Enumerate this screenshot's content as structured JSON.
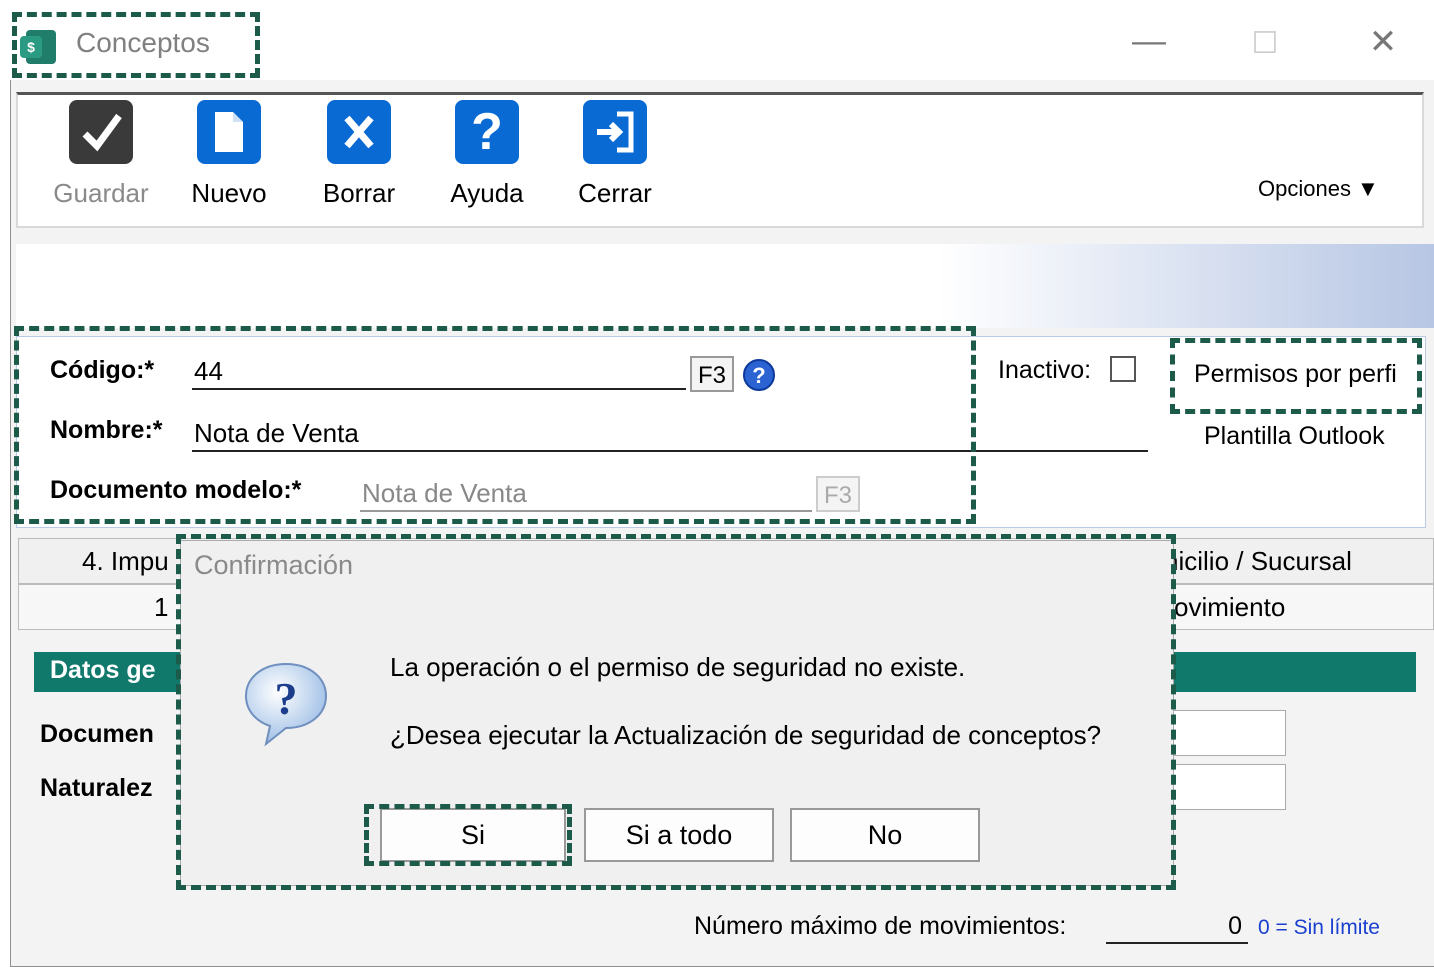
{
  "window": {
    "title": "Conceptos",
    "controls": {
      "minimize": "—",
      "maximize": "☐",
      "close": "✕"
    }
  },
  "toolbar": {
    "buttons": [
      {
        "label": "Guardar",
        "icon": "check-icon",
        "enabled": false
      },
      {
        "label": "Nuevo",
        "icon": "document-icon",
        "enabled": true
      },
      {
        "label": "Borrar",
        "icon": "delete-x-icon",
        "enabled": true
      },
      {
        "label": "Ayuda",
        "icon": "help-question-icon",
        "enabled": true
      },
      {
        "label": "Cerrar",
        "icon": "exit-door-icon",
        "enabled": true
      }
    ],
    "options_label": "Opciones ▼"
  },
  "form": {
    "codigo_label": "Código:*",
    "codigo_value": "44",
    "nombre_label": "Nombre:*",
    "nombre_value": "Nota de Venta",
    "documento_label": "Documento modelo:*",
    "documento_value": "Nota de Venta",
    "f3_label": "F3",
    "inactivo_label": "Inactivo:",
    "inactivo_checked": false,
    "permisos_label": "Permisos por perfi",
    "plantilla_label": "Plantilla Outlook"
  },
  "tabs": {
    "row1_left": "4. Impu",
    "row1_right": "nicilio / Sucursal",
    "row2_left": "1",
    "row2_right": "ovimiento"
  },
  "section": {
    "header": "Datos ge",
    "label1": "Documen",
    "label2": "Naturalez"
  },
  "footer": {
    "max_label": "Número máximo de movimientos:",
    "max_value": "0",
    "max_hint": "0 = Sin límite"
  },
  "dialog": {
    "title": "Confirmación",
    "icon": "question-balloon-icon",
    "line1": "La operación o el permiso de seguridad no existe.",
    "line2": "¿Desea ejecutar la Actualización de seguridad de conceptos?",
    "btn_yes": "Si",
    "btn_yes_all": "Si a todo",
    "btn_no": "No"
  },
  "colors": {
    "highlight_dash": "#1c5a4a",
    "toolbar_blue": "#0a6ad4",
    "section_teal": "#11786c",
    "hint_blue": "#1a3fcf"
  }
}
